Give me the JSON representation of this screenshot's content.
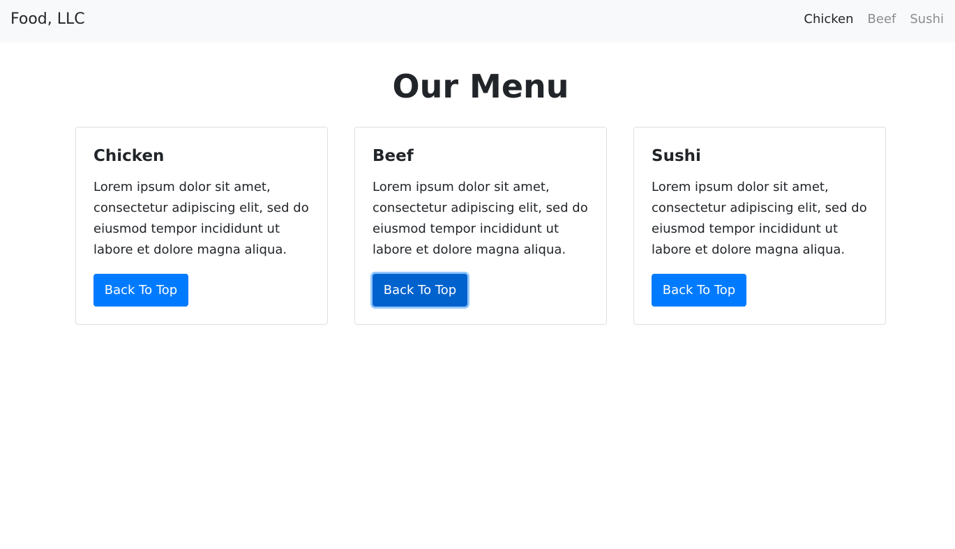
{
  "navbar": {
    "brand": "Food, LLC",
    "links": [
      {
        "label": "Chicken",
        "active": true
      },
      {
        "label": "Beef",
        "active": false
      },
      {
        "label": "Sushi",
        "active": false
      }
    ]
  },
  "main": {
    "title": "Our Menu",
    "cards": [
      {
        "title": "Chicken",
        "text": "Lorem ipsum dolor sit amet, consectetur adipiscing elit, sed do eiusmod tempor incididunt ut labore et dolore magna aliqua.",
        "button_label": "Back To Top"
      },
      {
        "title": "Beef",
        "text": "Lorem ipsum dolor sit amet, consectetur adipiscing elit, sed do eiusmod tempor incididunt ut labore et dolore magna aliqua.",
        "button_label": "Back To Top"
      },
      {
        "title": "Sushi",
        "text": "Lorem ipsum dolor sit amet, consectetur adipiscing elit, sed do eiusmod tempor incididunt ut labore et dolore magna aliqua.",
        "button_label": "Back To Top"
      }
    ]
  },
  "colors": {
    "primary": "#007bff",
    "primary_focused": "#0062cc",
    "navbar_bg": "#f8f9fa",
    "nav_link_muted": "#8a8d90"
  }
}
